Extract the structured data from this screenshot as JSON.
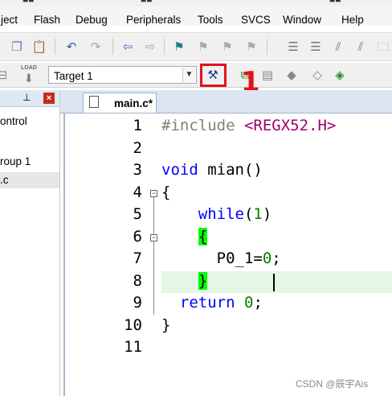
{
  "menu": {
    "items": [
      "ject",
      "Flash",
      "Debug",
      "Peripherals",
      "Tools",
      "SVCS",
      "Window",
      "Help"
    ]
  },
  "toolbar1": {
    "icons": [
      "copy-icon",
      "paste-icon",
      "undo-icon",
      "redo-icon",
      "nav-back-icon",
      "nav-forward-icon",
      "bookmark-icon",
      "prev-bookmark-icon",
      "next-bookmark-icon",
      "clear-bookmarks-icon",
      "indent-icon",
      "unindent-icon",
      "comment-icon",
      "uncomment-icon",
      "find-in-files-icon"
    ]
  },
  "toolbar2": {
    "target_value": "Target 1",
    "load_label": "LOAD",
    "icons": [
      "download-icon",
      "load-icon",
      "options-for-target-icon",
      "file-extensions-icon",
      "manage-components-icon",
      "select-packs-icon",
      "pack-installer-icon"
    ]
  },
  "annotation": {
    "text": "1",
    "color": "#e3131b"
  },
  "project_panel": {
    "rows": [
      "ontrol",
      "roup 1",
      ".c"
    ]
  },
  "editor": {
    "tab_label": "main.c*",
    "line_numbers": [
      "1",
      "2",
      "3",
      "4",
      "5",
      "6",
      "7",
      "8",
      "9",
      "10",
      "11"
    ],
    "lines": [
      {
        "parts": [
          {
            "t": "#include ",
            "c": "pp"
          },
          {
            "t": "<REGX52.H>",
            "c": "str"
          }
        ]
      },
      {
        "parts": []
      },
      {
        "parts": [
          {
            "t": "void",
            "c": "kw"
          },
          {
            "t": " mian()",
            "c": ""
          }
        ]
      },
      {
        "parts": [
          {
            "t": "{",
            "c": ""
          }
        ]
      },
      {
        "parts": [
          {
            "t": "    ",
            "c": ""
          },
          {
            "t": "while",
            "c": "kw"
          },
          {
            "t": "(",
            "c": ""
          },
          {
            "t": "1",
            "c": "num"
          },
          {
            "t": ")",
            "c": ""
          }
        ]
      },
      {
        "parts": [
          {
            "t": "    ",
            "c": ""
          },
          {
            "t": "{",
            "c": "brace-hl"
          }
        ]
      },
      {
        "parts": [
          {
            "t": "      P0_1=",
            "c": ""
          },
          {
            "t": "0",
            "c": "num"
          },
          {
            "t": ";",
            "c": ""
          }
        ]
      },
      {
        "parts": [
          {
            "t": "    ",
            "c": ""
          },
          {
            "t": "}",
            "c": "brace-hl"
          }
        ]
      },
      {
        "parts": [
          {
            "t": "  ",
            "c": ""
          },
          {
            "t": "return",
            "c": "kw"
          },
          {
            "t": " ",
            "c": ""
          },
          {
            "t": "0",
            "c": "num"
          },
          {
            "t": ";",
            "c": ""
          }
        ]
      },
      {
        "parts": [
          {
            "t": "}",
            "c": ""
          }
        ]
      },
      {
        "parts": []
      }
    ],
    "colors": {
      "keyword": "#0000ff",
      "preprocessor": "#808080",
      "string": "#a0006b",
      "number": "#008000",
      "current_line": "#e4f6e4",
      "brace_match": "#00ff00"
    }
  },
  "watermark": "CSDN @辰宇Ais"
}
